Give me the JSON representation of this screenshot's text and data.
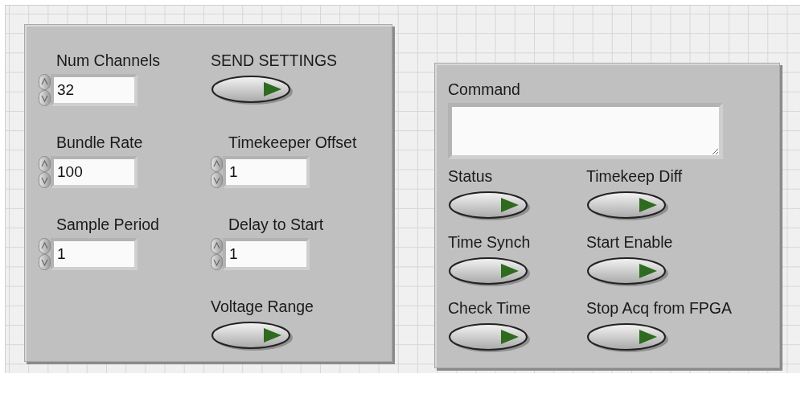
{
  "panels": [
    {
      "controls": [
        {
          "kind": "numeric",
          "label": "Num Channels",
          "value": "32"
        },
        {
          "kind": "boolean",
          "label": "SEND SETTINGS",
          "on": false
        },
        {
          "kind": "numeric",
          "label": "Bundle Rate",
          "value": "100"
        },
        {
          "kind": "numeric",
          "label": "Timekeeper Offset",
          "value": "1"
        },
        {
          "kind": "numeric",
          "label": "Sample Period",
          "value": "1"
        },
        {
          "kind": "numeric",
          "label": "Delay to Start",
          "value": "1"
        },
        {
          "kind": "boolean",
          "label": "Voltage Range",
          "on": false
        }
      ]
    },
    {
      "controls": [
        {
          "kind": "string",
          "label": "Command"
        },
        {
          "kind": "boolean",
          "label": "Status",
          "on": false
        },
        {
          "kind": "boolean",
          "label": "Timekeep Diff",
          "on": false
        },
        {
          "kind": "boolean",
          "label": "Time Synch",
          "on": false
        },
        {
          "kind": "boolean",
          "label": "Start Enable",
          "on": false
        },
        {
          "kind": "boolean",
          "label": "Check Time",
          "on": false
        },
        {
          "kind": "boolean",
          "label": "Stop Acq from FPGA",
          "on": false
        }
      ]
    }
  ]
}
